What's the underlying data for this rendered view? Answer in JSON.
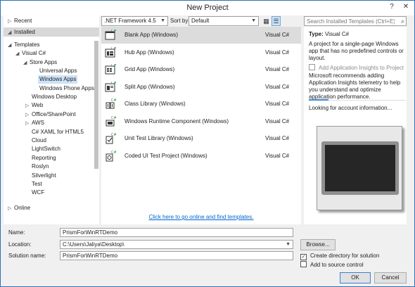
{
  "window": {
    "title": "New Project",
    "help": "?",
    "close": "✕"
  },
  "tree": {
    "recent": "Recent",
    "installed": "Installed",
    "templates": "Templates",
    "visual_csharp": "Visual C#",
    "store_apps": "Store Apps",
    "universal_apps": "Universal Apps",
    "windows_apps": "Windows Apps",
    "windows_phone_apps": "Windows Phone Apps",
    "windows_desktop": "Windows Desktop",
    "web": "Web",
    "office_sharepoint": "Office/SharePoint",
    "aws": "AWS",
    "csharp_xaml_html5": "C# XAML for HTML5",
    "cloud": "Cloud",
    "lightswitch": "LightSwitch",
    "reporting": "Reporting",
    "roslyn": "Roslyn",
    "silverlight": "Silverlight",
    "test": "Test",
    "wcf": "WCF",
    "online": "Online"
  },
  "toolbar": {
    "framework": ".NET Framework 4.5",
    "sort_label": "Sort by:",
    "sort_value": "Default"
  },
  "templates": [
    {
      "name": "Blank App (Windows)",
      "lang": "Visual C#"
    },
    {
      "name": "Hub App (Windows)",
      "lang": "Visual C#"
    },
    {
      "name": "Grid App (Windows)",
      "lang": "Visual C#"
    },
    {
      "name": "Split App (Windows)",
      "lang": "Visual C#"
    },
    {
      "name": "Class Library (Windows)",
      "lang": "Visual C#"
    },
    {
      "name": "Windows Runtime Component (Windows)",
      "lang": "Visual C#"
    },
    {
      "name": "Unit Test Library (Windows)",
      "lang": "Visual C#"
    },
    {
      "name": "Coded UI Test Project (Windows)",
      "lang": "Visual C#"
    }
  ],
  "online_link": "Click here to go online and find templates.",
  "search": {
    "placeholder": "Search Installed Templates (Ctrl+E)"
  },
  "details": {
    "type_label": "Type:",
    "type_value": "Visual C#",
    "description": "A project for a single-page Windows app that has no predefined controls or layout.",
    "ai_checkbox": "Add Application Insights to Project",
    "ai_text": "Microsoft recommends adding Application Insights telemetry to help you understand and optimize application performance.",
    "ai_progress": 0.2,
    "looking": "Looking for account information..."
  },
  "form": {
    "name_label": "Name:",
    "name_value": "PrismForWinRTDemo",
    "location_label": "Location:",
    "location_value": "C:\\Users\\Jaliya\\Desktop\\",
    "solution_label": "Solution name:",
    "solution_value": "PrismForWinRTDemo",
    "browse": "Browse...",
    "create_dir": "Create directory for solution",
    "create_dir_checked": true,
    "source_control": "Add to source control",
    "source_control_checked": false,
    "ok": "OK",
    "cancel": "Cancel"
  },
  "colors": {
    "accent": "#3f86d4",
    "selection": "#cde3f7",
    "link": "#0066cc"
  }
}
